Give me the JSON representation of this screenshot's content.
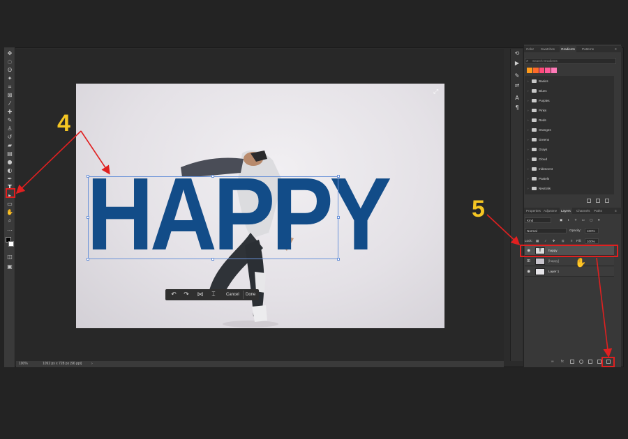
{
  "toolbar": {
    "icons": [
      "move-icon",
      "marquee-icon",
      "lasso-icon",
      "magic-wand-icon",
      "crop-icon",
      "frame-icon",
      "eyedropper-icon",
      "healing-icon",
      "brush-icon",
      "stamp-icon",
      "history-brush-icon",
      "eraser-icon",
      "gradient-icon",
      "blur-icon",
      "dodge-icon",
      "pen-icon",
      "type-icon",
      "path-select-icon",
      "shape-icon",
      "hand-icon",
      "zoom-icon",
      "more-icon"
    ]
  },
  "document": {
    "text_layer_content": "HAPPY",
    "text_color": "#124c88"
  },
  "context_bar": {
    "cancel_label": "Cancel",
    "done_label": "Done"
  },
  "status": {
    "zoom": "100%",
    "doc_size": "1092 px x 728 px (96 ppi)"
  },
  "gradients_panel": {
    "tabs": [
      "Color",
      "Swatches",
      "Gradients",
      "Patterns"
    ],
    "active_tab": "Gradients",
    "search_placeholder": "Search Gradients",
    "swatch_colors": [
      "#ff9a1a",
      "#ff6a2a",
      "#ff4a7a",
      "#ff5a9a",
      "#ff7ab8"
    ],
    "folders": [
      "Basics",
      "Blues",
      "Purples",
      "Pinks",
      "Reds",
      "Oranges",
      "Greens",
      "Grays",
      "Cloud",
      "Iridescent",
      "Pastels",
      "Neutrals"
    ]
  },
  "layers_panel": {
    "tabs": [
      "Properties",
      "Adjustme",
      "Layers",
      "Channels",
      "Paths"
    ],
    "active_tab": "Layers",
    "kind_label": "Kind",
    "blend_mode": "Normal",
    "opacity_label": "Opacity:",
    "opacity_value": "100%",
    "lock_label": "Lock:",
    "fill_label": "Fill:",
    "fill_value": "100%",
    "layers": [
      {
        "name": "happy",
        "type": "text",
        "thumb": "T",
        "selected": true
      },
      {
        "name": "[happy]",
        "type": "smart",
        "thumb": "",
        "selected": false
      },
      {
        "name": "Layer 1",
        "type": "pixel",
        "thumb": "",
        "selected": false
      }
    ]
  },
  "annotations": {
    "step4": "4",
    "step5": "5",
    "color": "#e02020",
    "number_color": "#f5c623"
  }
}
